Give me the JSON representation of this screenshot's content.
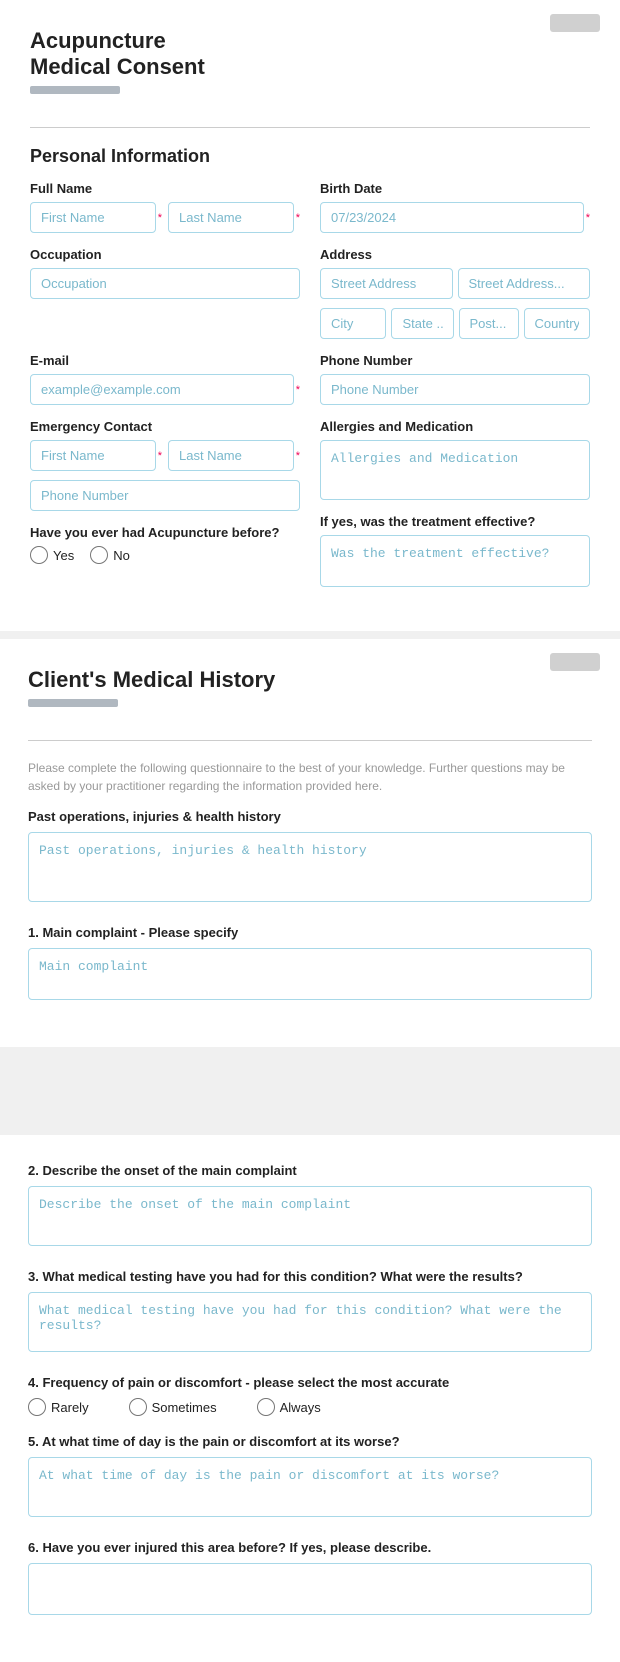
{
  "personal": {
    "title": "Acupuncture\nMedical Consent",
    "subtitle": "Personal Information",
    "fields": {
      "fullname_label": "Full Name",
      "firstname_placeholder": "First Name",
      "lastname_placeholder": "Last Name",
      "birthdate_label": "Birth Date",
      "birthdate_value": "07/23/2024",
      "occupation_label": "Occupation",
      "occupation_placeholder": "Occupation",
      "address_label": "Address",
      "street1_placeholder": "Street Address",
      "street2_placeholder": "Street Address...",
      "city_placeholder": "City",
      "state_placeholder": "State ...",
      "postal_placeholder": "Post...",
      "country_placeholder": "Country",
      "email_label": "E-mail",
      "email_placeholder": "example@example.com",
      "phone_label": "Phone Number",
      "phone_placeholder": "Phone Number",
      "emergency_label": "Emergency Contact",
      "emergency_firstname_placeholder": "First Name",
      "emergency_lastname_placeholder": "Last Name",
      "emergency_phone_placeholder": "Phone Number",
      "acupuncture_label": "Have you ever had Acupuncture before?",
      "yes_label": "Yes",
      "no_label": "No",
      "allergies_label": "Allergies and Medication",
      "allergies_placeholder": "Allergies and Medication",
      "if_yes_label": "If yes, was the treatment effective?",
      "effective_placeholder": "Was the treatment effective?"
    }
  },
  "medical": {
    "title": "Client's Medical History",
    "desc": "Please complete the following questionnaire to the best of your knowledge. Further questions may be asked by your practitioner regarding the information provided here.",
    "past_label": "Past operations, injuries & health history",
    "past_placeholder": "Past operations, injuries & health history",
    "q1_label": "1. Main complaint - Please specify",
    "q1_placeholder": "Main complaint",
    "q2_label": "2. Describe the onset of the main complaint",
    "q2_placeholder": "Describe the onset of the main complaint",
    "q3_label": "3. What medical testing have you had for this condition? What were the results?",
    "q3_placeholder": "What medical testing have you had for this condition? What were the results?",
    "q4_label": "4. Frequency of pain or discomfort - please select the most accurate",
    "rarely_label": "Rarely",
    "sometimes_label": "Sometimes",
    "always_label": "Always",
    "q5_label": "5. At what time of day is the pain or discomfort at its worse?",
    "q5_placeholder": "At what time of day is the pain or discomfort at its worse?",
    "q6_label": "6. Have you ever injured this area before? If yes, please describe."
  }
}
